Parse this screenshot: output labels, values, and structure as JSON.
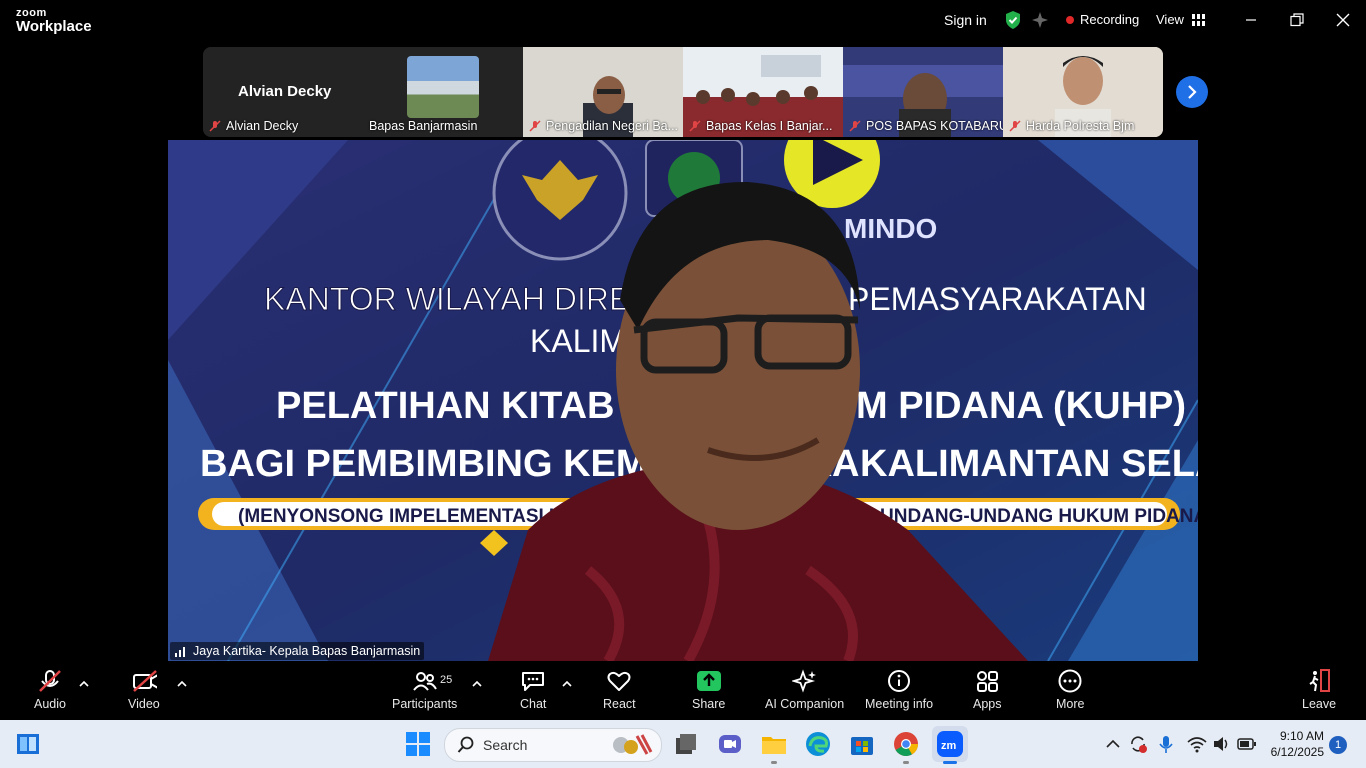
{
  "app": {
    "logo_line1": "zoom",
    "logo_line2": "Workplace"
  },
  "titlebar": {
    "sign_in": "Sign in",
    "recording": "Recording",
    "view": "View"
  },
  "thumbnails": [
    {
      "name": "Alvian Decky",
      "display_text": "Alvian Decky",
      "muted": true
    },
    {
      "name": "Bapas Banjarmasin",
      "muted": false
    },
    {
      "name": "Pengadilan Negeri Ba...",
      "muted": true
    },
    {
      "name": "Bapas Kelas I Banjar...",
      "muted": true
    },
    {
      "name": "POS BAPAS KOTABARU",
      "muted": true
    },
    {
      "name": "Harda Polresta Bjm",
      "muted": true
    }
  ],
  "main_video": {
    "speaker_name": "Jaya Kartika- Kepala Bapas Banjarmasin",
    "slide": {
      "line1": "KANTOR WILAYAH DIREKTO",
      "line1_right": "PEMASYARAKATAN",
      "line2": "KALIMA",
      "title1_left": "PELATIHAN KITAB UNDAN",
      "title1_right": "M PIDANA (KUHP)",
      "title2_left": "BAGI PEMBIMBING KEMASYARAKA",
      "title2_right": "KALIMANTAN SELATAN",
      "banner_left": "(MENYONSONG IMPELEMENTASI UNDANG-UNDANG NOMOR 1",
      "banner_right": "UNDANG-UNDANG HUKUM PIDANA)",
      "logo_text": "MINDO"
    }
  },
  "toolbar": {
    "audio": "Audio",
    "video": "Video",
    "participants": "Participants",
    "participants_count": "25",
    "chat": "Chat",
    "react": "React",
    "share": "Share",
    "ai_companion": "AI Companion",
    "meeting_info": "Meeting info",
    "apps": "Apps",
    "more": "More",
    "leave": "Leave"
  },
  "taskbar": {
    "search_placeholder": "Search",
    "time": "9:10 AM",
    "date": "6/12/2025",
    "notification_count": "1"
  },
  "colors": {
    "share_green": "#22c55e",
    "recording_red": "#e02828",
    "accent_blue": "#1f6fe6",
    "shield_green": "#22b04a"
  }
}
